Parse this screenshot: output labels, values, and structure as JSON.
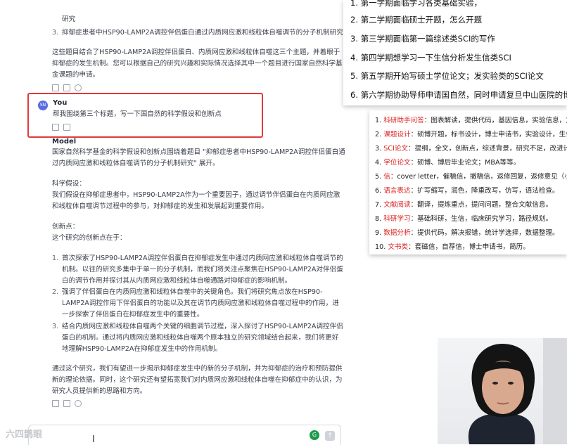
{
  "chat": {
    "prev_items": [
      {
        "text": "研究",
        "num": ""
      },
      {
        "text": "抑郁症患者中HSP90-LAMP2A调控伴侣蛋白通过内质网应激和线粒体自噬调节的分子机制研究",
        "num": "3."
      }
    ],
    "prev_summary": [
      "这些题目结合了HSP90-LAMP2A调控伴侣蛋白、内质网应激和线粒体自噬这三个主题，并着眼于",
      "抑郁症的发生机制。您可以根据自己的研究兴趣和实际情况选择其中一个题目进行国家自然科学基",
      "金课题的申请。"
    ],
    "user_label": "You",
    "user_avatar": "SN",
    "user_message": "帮我围绕第三个标题，写一下国自然的科学假设和创新点",
    "model_label": "Model",
    "model_intro": [
      "国家自然科学基金的科学假设和创新点围绕着题目 \"抑郁症患者中HSP90-LAMP2A调控伴侣蛋白通",
      "过内质网应激和线粒体自噬调节的分子机制研究\" 展开。"
    ],
    "hypothesis_title": "科学假设：",
    "hypothesis": [
      "我们假设在抑郁症患者中，HSP90-LAMP2A作为一个重要因子，通过调节伴侣蛋白在内质网应激",
      "和线粒体自噬调节过程中的参与，对抑郁症的发生和发展起到重要作用。"
    ],
    "innovation_title": "创新点：",
    "innovation_intro": "这个研究的创新点在于：",
    "innovation_items": [
      {
        "num": "1.",
        "lines": [
          "首次探索了HSP90-LAMP2A调控伴侣蛋白在抑郁症发生中通过内质网应激和线粒体自噬调节的",
          "机制。以往的研究多集中于单一的分子机制，而我们将关注点聚焦在HSP90-LAMP2A对伴侣蛋",
          "白的调节作用并探讨其从内质网应激和线粒体自噬通路对抑郁症的影响机制。"
        ]
      },
      {
        "num": "2.",
        "lines": [
          "强调了伴侣蛋白在内质网应激和线粒体自噬中的关键角色。我们将研究焦点放在HSP90-",
          "LAMP2A调控作用下伴侣蛋白的功能以及其在调节内质网应激和线粒体自噬过程中的作用，进",
          "一步探索了伴侣蛋白在抑郁症发生中的重要性。"
        ]
      },
      {
        "num": "3.",
        "lines": [
          "结合内质网应激和线粒体自噬两个关键的细胞调节过程，深入探讨了HSP90-LAMP2A调控伴侣",
          "蛋白的机制。通过将内质网应激和线粒体自噬两个原本独立的研究领域结合起来，我们将更好",
          "地理解HSP90-LAMP2A在抑郁症发生中的作用机制。"
        ]
      }
    ],
    "conclusion": [
      "通过这个研究，我们有望进一步揭示抑郁症发生中的新的分子机制，并为抑郁症的治疗和预防提供",
      "新的理论依据。同时，这个研究还有望拓宽我们对内质网应激和线粒体自噬在抑郁症中的认识，为",
      "研究人员提供新的思路和方向。"
    ],
    "watermark": "六四鹊眼",
    "input_placeholder": ""
  },
  "plan_panel": {
    "items": [
      {
        "num": "1.",
        "text": "第一学期面临学习各类基础实验，"
      },
      {
        "num": "2.",
        "text": "第二学期面临硕士开题，怎么开题"
      },
      {
        "num": "3.",
        "text": "第三学期面临第一篇综述类SCI的写作"
      },
      {
        "num": "4.",
        "text": "第四学期想学习一下生信分析发生信类SCI"
      },
      {
        "num": "5.",
        "text": "第五学期开始写硕士学位论文；发实验类的SCI论文"
      },
      {
        "num": "6.",
        "text": "第六学期协助导师申请国自然，同时申请复旦中山医院的博士"
      }
    ]
  },
  "service_panel": {
    "items": [
      {
        "num": "1.",
        "key": "科研助手问答",
        "text": "：图表解读，提供代码，基因信息，实验信息，文"
      },
      {
        "num": "2.",
        "key": "课题设计",
        "text": "：硕博开题，标书设计，博士申请书，实验设计，生信"
      },
      {
        "num": "3.",
        "key": "SCI论文",
        "text": "：提纲，全文，创新点，综述背景，研究不足，改进计"
      },
      {
        "num": "4.",
        "key": "学位论文",
        "text": "：硕博、博后毕业论文；MBA等等。"
      },
      {
        "num": "5.",
        "key": "信",
        "text": "：cover letter，催稿信，撤稿信，返修回复，返修意见（小"
      },
      {
        "num": "6.",
        "key": "语言表达",
        "text": "：扩写缩写，润色，降重改写，仿写，语法检查。"
      },
      {
        "num": "7.",
        "key": "文献阅读",
        "text": "：翻译，提炼重点，提问问题，整合文献信息。"
      },
      {
        "num": "8.",
        "key": "科研学习",
        "text": "：基础科研，生信，临床研究学习，路径规划。"
      },
      {
        "num": "9.",
        "key": "数据分析",
        "text": "：提供代码，解决报错，统计学选择，数据整理。"
      },
      {
        "num": "10.",
        "key": "文书类",
        "text": "：套磁信，自荐信，博士申请书，简历。"
      }
    ]
  },
  "colors": {
    "highlight": "#e03a3a",
    "service_key": "#d22222",
    "avatar": "#5a6de0"
  }
}
